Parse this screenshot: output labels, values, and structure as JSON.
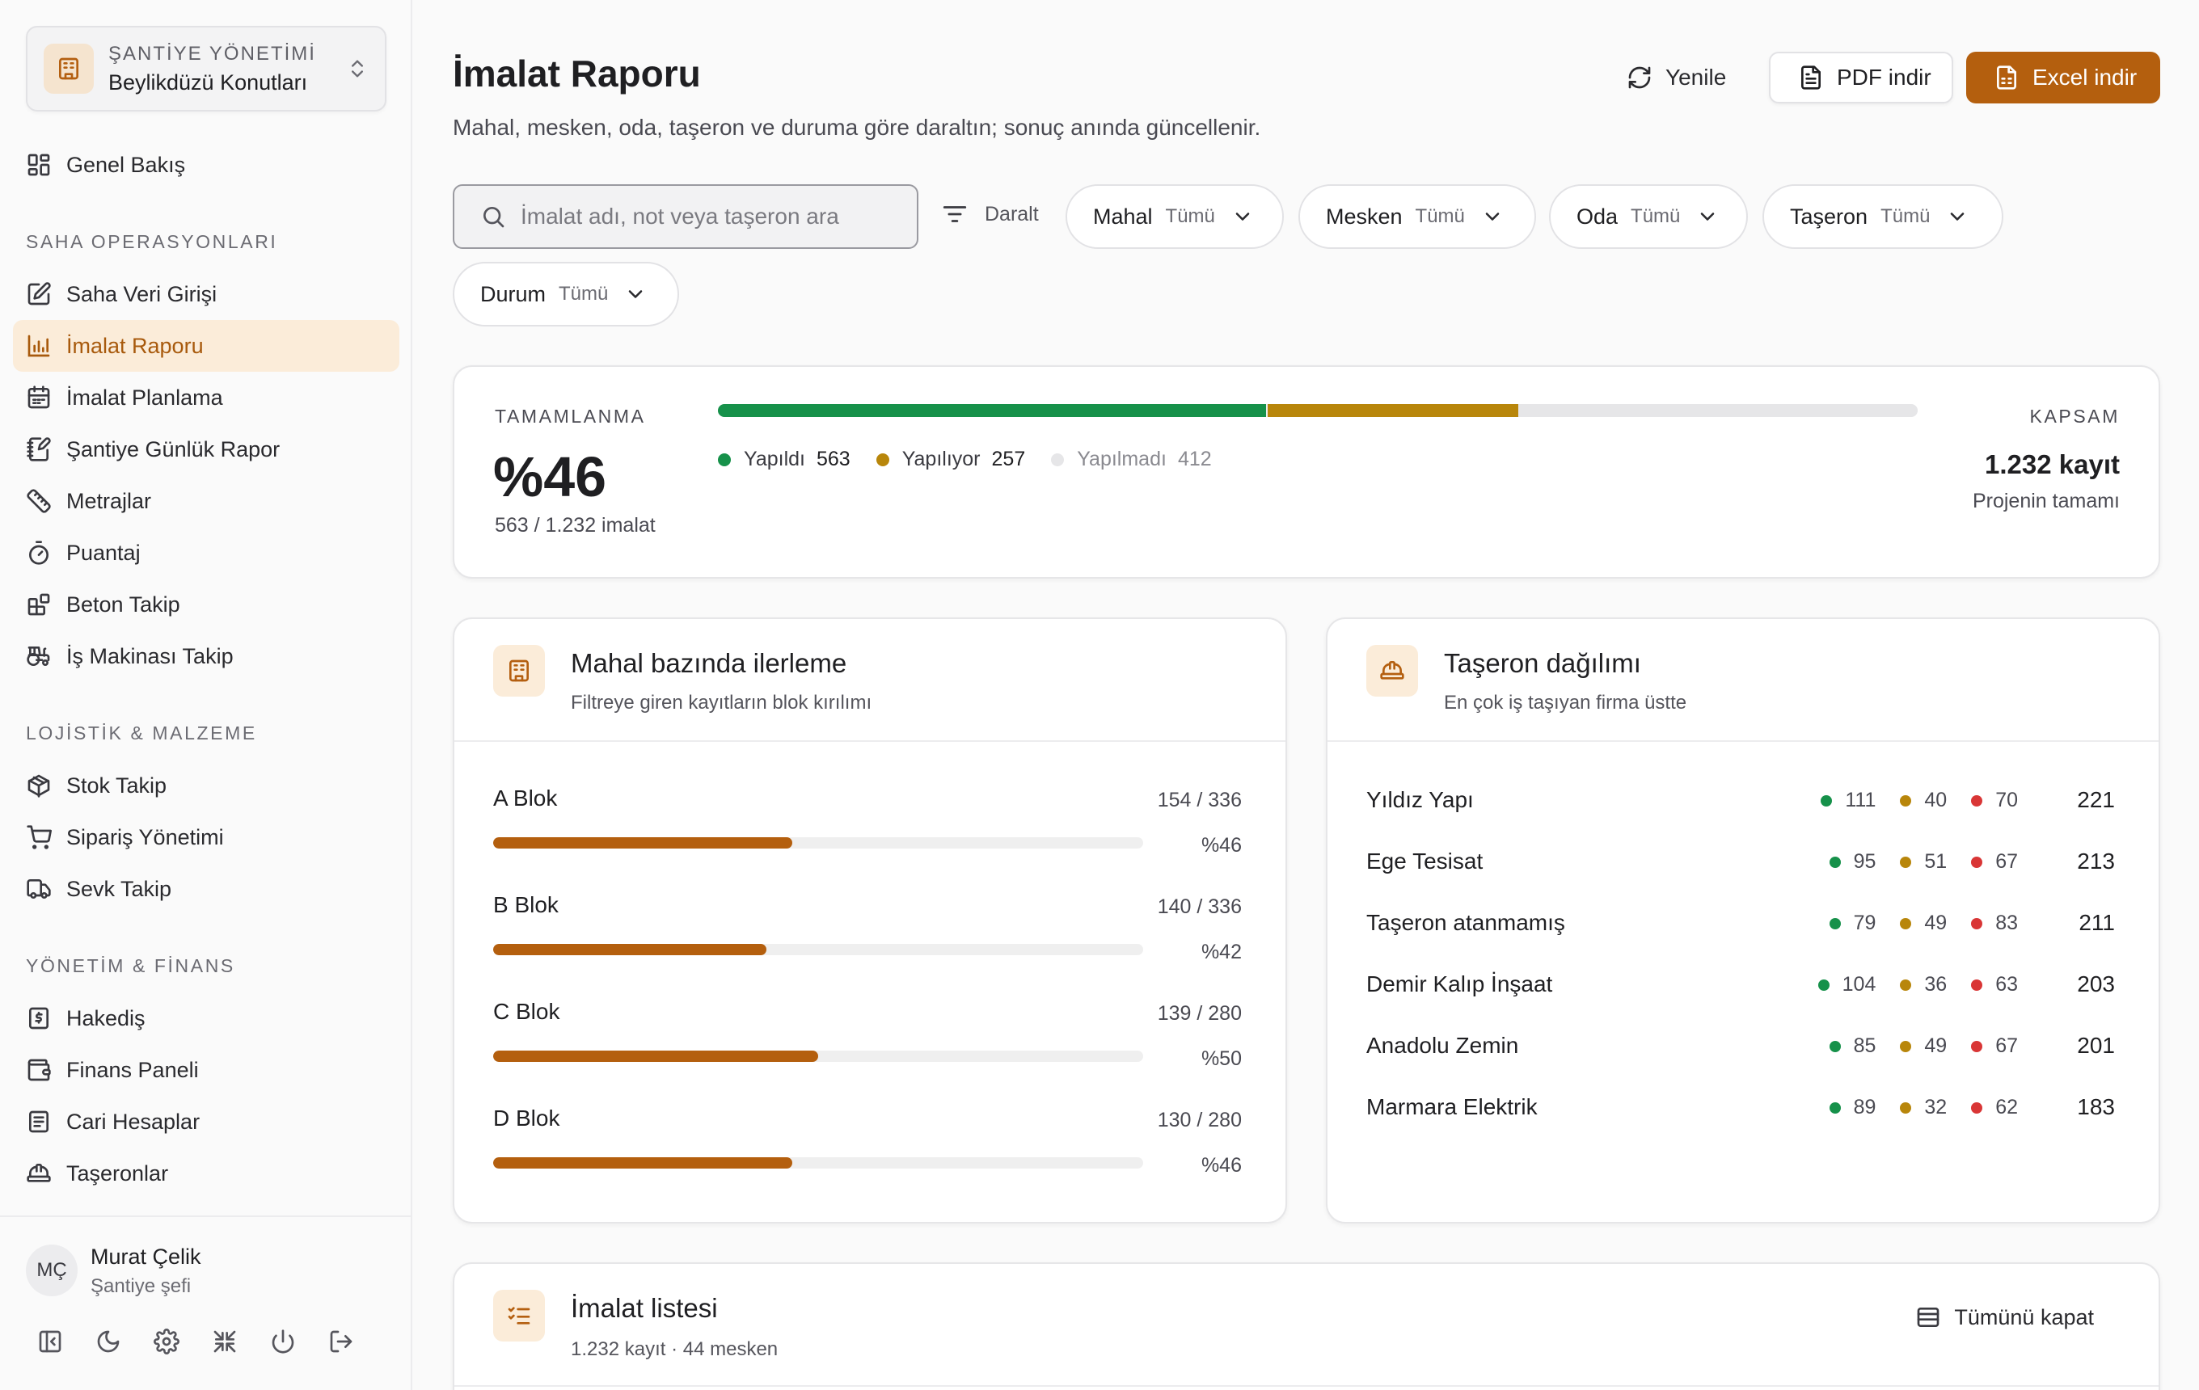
{
  "workspace": {
    "org": "ŞANTİYE YÖNETİMİ",
    "project": "Beylikdüzü Konutları"
  },
  "nav": {
    "overview": "Genel Bakış",
    "sections": {
      "field": "SAHA OPERASYONLARI",
      "logistics": "LOJİSTİK & MALZEME",
      "finance": "YÖNETİM & FİNANS"
    },
    "items": {
      "field_entry": "Saha Veri Girişi",
      "production_report": "İmalat Raporu",
      "production_planning": "İmalat Planlama",
      "daily_report": "Şantiye Günlük Rapor",
      "quantities": "Metrajlar",
      "timesheet": "Puantaj",
      "concrete": "Beton Takip",
      "machinery": "İş Makinası Takip",
      "stock": "Stok Takip",
      "orders": "Sipariş Yönetimi",
      "shipment": "Sevk Takip",
      "progress_payment": "Hakediş",
      "finance_panel": "Finans Paneli",
      "accounts": "Cari Hesaplar",
      "subcontractors": "Taşeronlar"
    }
  },
  "user": {
    "initials": "MÇ",
    "name": "Murat Çelik",
    "role": "Şantiye şefi"
  },
  "header": {
    "title": "İmalat Raporu",
    "subtitle": "Mahal, mesken, oda, taşeron ve duruma göre daraltın; sonuç anında güncellenir.",
    "refresh": "Yenile",
    "pdf": "PDF indir",
    "excel": "Excel indir"
  },
  "filters": {
    "search_placeholder": "İmalat adı, not veya taşeron ara",
    "search_value": "",
    "toggle": "Daralt",
    "chips": [
      {
        "label": "Mahal",
        "value": "Tümü"
      },
      {
        "label": "Mesken",
        "value": "Tümü"
      },
      {
        "label": "Oda",
        "value": "Tümü"
      },
      {
        "label": "Taşeron",
        "value": "Tümü"
      },
      {
        "label": "Durum",
        "value": "Tümü"
      }
    ]
  },
  "completion": {
    "label": "TAMAMLANMA",
    "percent": "%46",
    "sub": "563 / 1.232 imalat",
    "legend": [
      {
        "name": "Yapıldı",
        "value": "563",
        "count": 563,
        "color": "#16914a"
      },
      {
        "name": "Yapılıyor",
        "value": "257",
        "count": 257,
        "color": "#b8860b"
      },
      {
        "name": "Yapılmadı",
        "value": "412",
        "count": 412,
        "color": "#e6e6e8"
      }
    ],
    "total": 1232,
    "scope_label": "KAPSAM",
    "scope_value": "1.232 kayıt",
    "scope_sub": "Projenin tamamı"
  },
  "blocks_panel": {
    "title": "Mahal bazında ilerleme",
    "subtitle": "Filtreye giren kayıtların blok kırılımı",
    "rows": [
      {
        "name": "A Blok",
        "count": "154 / 336",
        "percent": "%46",
        "fill": 0.46
      },
      {
        "name": "B Blok",
        "count": "140 / 336",
        "percent": "%42",
        "fill": 0.42
      },
      {
        "name": "C Blok",
        "count": "139 / 280",
        "percent": "%50",
        "fill": 0.5
      },
      {
        "name": "D Blok",
        "count": "130 / 280",
        "percent": "%46",
        "fill": 0.46
      }
    ]
  },
  "subcontractor_panel": {
    "title": "Taşeron dağılımı",
    "subtitle": "En çok iş taşıyan firma üstte",
    "status_colors": {
      "done": "#16914a",
      "in_progress": "#b8860b",
      "not_done": "#d93636"
    },
    "rows": [
      {
        "name": "Yıldız Yapı",
        "done": "111",
        "in_progress": "40",
        "not_done": "70",
        "total": "221"
      },
      {
        "name": "Ege Tesisat",
        "done": "95",
        "in_progress": "51",
        "not_done": "67",
        "total": "213"
      },
      {
        "name": "Taşeron atanmamış",
        "done": "79",
        "in_progress": "49",
        "not_done": "83",
        "total": "211"
      },
      {
        "name": "Demir Kalıp İnşaat",
        "done": "104",
        "in_progress": "36",
        "not_done": "63",
        "total": "203"
      },
      {
        "name": "Anadolu Zemin",
        "done": "85",
        "in_progress": "49",
        "not_done": "67",
        "total": "201"
      },
      {
        "name": "Marmara Elektrik",
        "done": "89",
        "in_progress": "32",
        "not_done": "62",
        "total": "183"
      }
    ]
  },
  "list_panel": {
    "title": "İmalat listesi",
    "subtitle": "1.232 kayıt · 44 mesken",
    "collapse": "Tümünü kapat"
  }
}
